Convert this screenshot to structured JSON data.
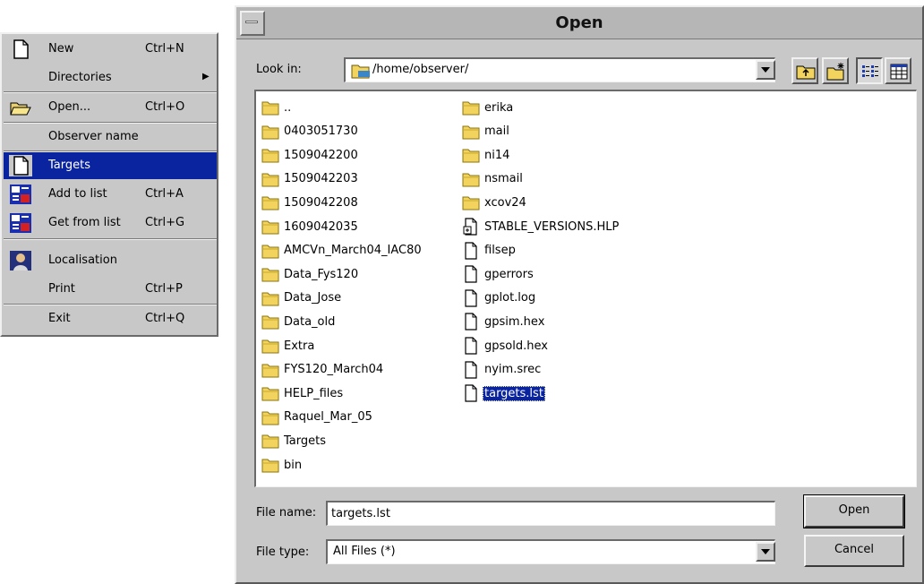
{
  "menu": {
    "items": [
      {
        "label": "New",
        "shortcut": "Ctrl+N",
        "icon": "document-icon"
      },
      {
        "label": "Directories",
        "shortcut": "",
        "icon": ""
      },
      {
        "label": "Open...",
        "shortcut": "Ctrl+O",
        "icon": "open-folder-icon"
      },
      {
        "label": "Observer name",
        "shortcut": "",
        "icon": ""
      },
      {
        "label": "Targets",
        "shortcut": "",
        "icon": "document-icon"
      },
      {
        "label": "Add to list",
        "shortcut": "Ctrl+A",
        "icon": "list-add-icon"
      },
      {
        "label": "Get from list",
        "shortcut": "Ctrl+G",
        "icon": "list-get-icon"
      },
      {
        "label": "Localisation",
        "shortcut": "",
        "icon": "localisation-icon"
      },
      {
        "label": "Print",
        "shortcut": "Ctrl+P",
        "icon": ""
      },
      {
        "label": "Exit",
        "shortcut": "Ctrl+Q",
        "icon": ""
      }
    ]
  },
  "dialog": {
    "title": "Open",
    "look_in_label": "Look in:",
    "look_in_value": "/home/observer/",
    "file_name_label": "File name:",
    "file_name_value": "targets.lst",
    "file_type_label": "File type:",
    "file_type_value": "All Files (*)",
    "open_button": "Open",
    "cancel_button": "Cancel",
    "left_column": [
      {
        "name": "..",
        "type": "folder"
      },
      {
        "name": "0403051730",
        "type": "folder"
      },
      {
        "name": "1509042200",
        "type": "folder"
      },
      {
        "name": "1509042203",
        "type": "folder"
      },
      {
        "name": "1509042208",
        "type": "folder"
      },
      {
        "name": "1609042035",
        "type": "folder"
      },
      {
        "name": "AMCVn_March04_IAC80",
        "type": "folder"
      },
      {
        "name": "Data_Fys120",
        "type": "folder"
      },
      {
        "name": "Data_Jose",
        "type": "folder"
      },
      {
        "name": "Data_old",
        "type": "folder"
      },
      {
        "name": "Extra",
        "type": "folder"
      },
      {
        "name": "FYS120_March04",
        "type": "folder"
      },
      {
        "name": "HELP_files",
        "type": "folder"
      },
      {
        "name": "Raquel_Mar_05",
        "type": "folder"
      },
      {
        "name": "Targets",
        "type": "folder"
      },
      {
        "name": "bin",
        "type": "folder"
      }
    ],
    "right_column": [
      {
        "name": "erika",
        "type": "folder"
      },
      {
        "name": "mail",
        "type": "folder"
      },
      {
        "name": "ni14",
        "type": "folder"
      },
      {
        "name": "nsmail",
        "type": "folder"
      },
      {
        "name": "xcov24",
        "type": "folder"
      },
      {
        "name": "STABLE_VERSIONS.HLP",
        "type": "help"
      },
      {
        "name": "filsep",
        "type": "file"
      },
      {
        "name": "gperrors",
        "type": "file"
      },
      {
        "name": "gplot.log",
        "type": "file"
      },
      {
        "name": "gpsim.hex",
        "type": "file"
      },
      {
        "name": "gpsold.hex",
        "type": "file"
      },
      {
        "name": "nyim.srec",
        "type": "file"
      },
      {
        "name": "targets.lst",
        "type": "file"
      }
    ]
  }
}
